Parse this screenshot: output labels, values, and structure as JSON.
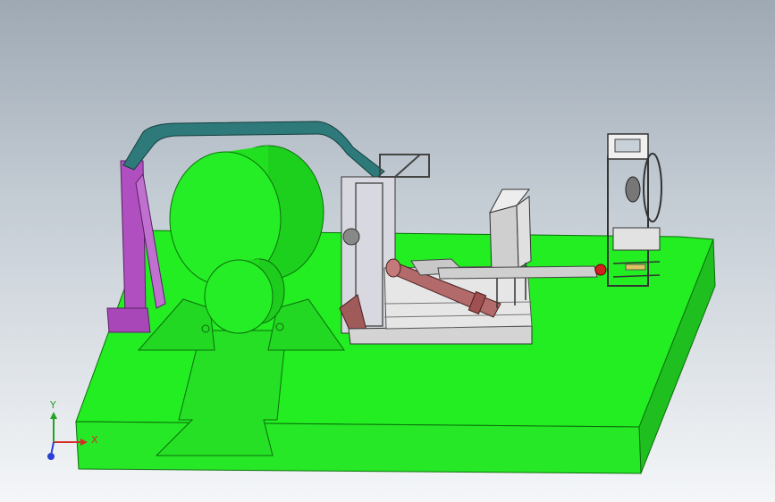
{
  "viewport": {
    "background_top": "#9ea9b4",
    "background_bottom": "#f4f6f8"
  },
  "model": {
    "base_color": "#22ee22",
    "drum_color": "#22ee22",
    "frame_color": "#b050c0",
    "rail_color": "#2e7a7a",
    "cylinder_color": "#b36a6a",
    "cabinet_color": "#d9d9d9",
    "metal_color": "#9a9a9a"
  },
  "triad": {
    "x_label": "X",
    "y_label": "Y",
    "x_color": "#d62a2a",
    "y_color": "#23a323",
    "z_color": "#2a3fd6"
  }
}
